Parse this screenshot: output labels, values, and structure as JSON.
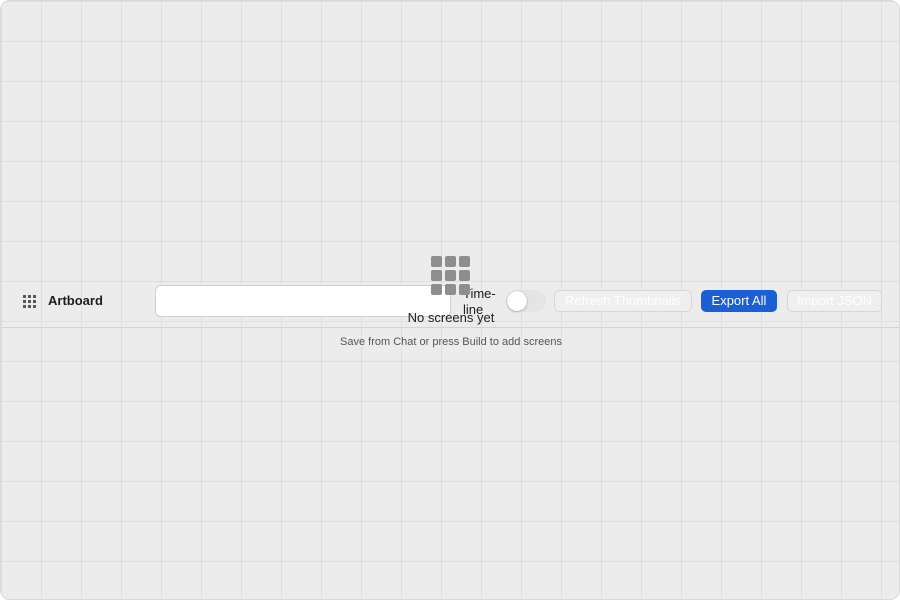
{
  "app": {
    "title": "Artboard",
    "icon": "grid-icon"
  },
  "toolbar": {
    "search": {
      "value": "",
      "placeholder": ""
    },
    "timeline_label": "Time-line",
    "timeline_toggle_on": false,
    "refresh_label": "Refresh Thumbnails",
    "export_label": "Export All",
    "import_label": "Import JSON"
  },
  "empty_state": {
    "icon": "grid-icon",
    "title": "No screens yet",
    "subtitle": "Save from Chat or press Build to add screens"
  },
  "colors": {
    "accent": "#1a5fd6",
    "canvas": "#ececec",
    "grid_line": "#dedede"
  }
}
